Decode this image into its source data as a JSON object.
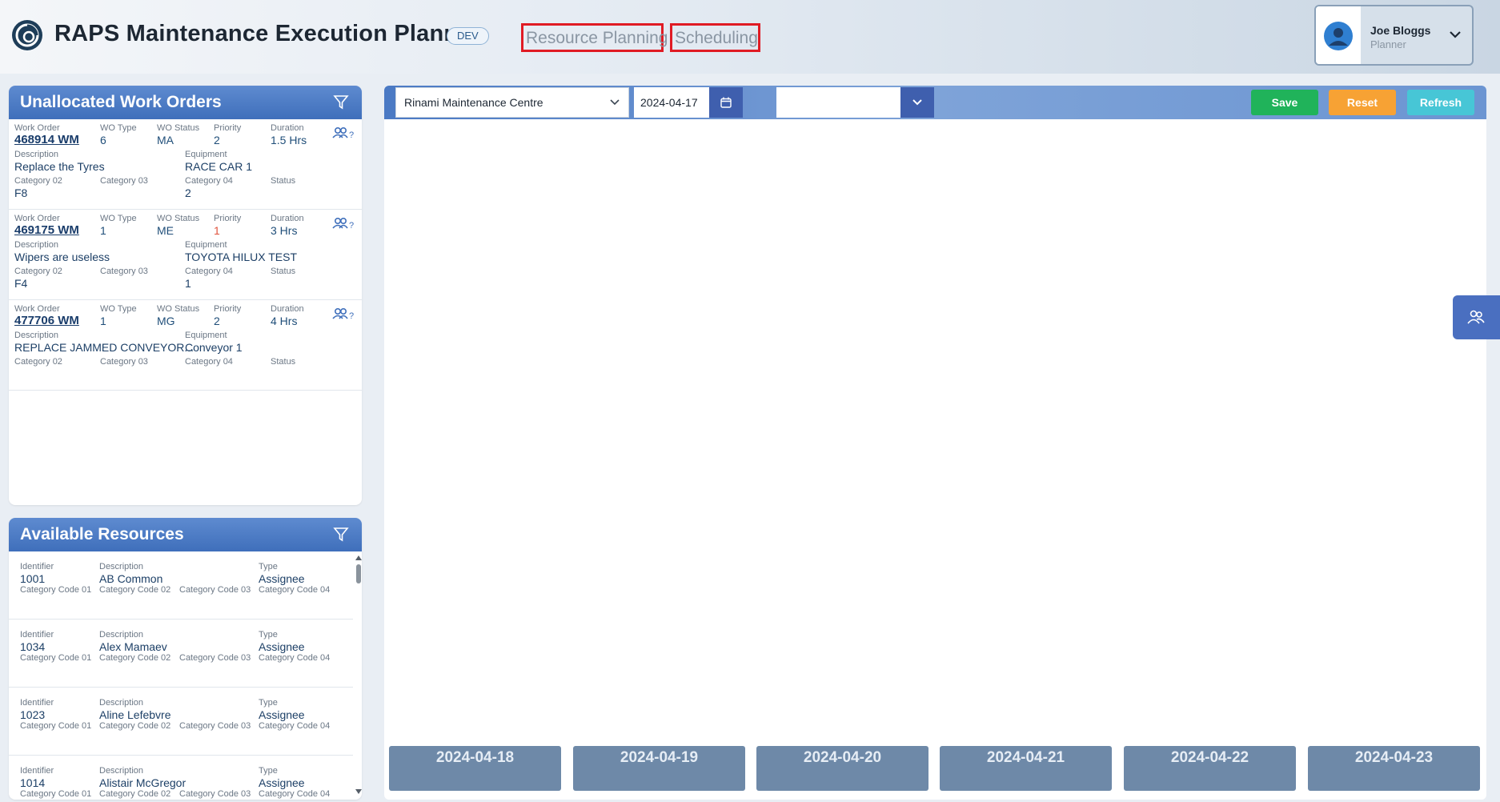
{
  "header": {
    "title": "RAPS Maintenance Execution Planner",
    "env_badge": "DEV",
    "nav": {
      "resource_planning": "Resource Planning",
      "scheduling": "Scheduling"
    },
    "user": {
      "name": "Joe Bloggs",
      "role": "Planner"
    }
  },
  "colors": {
    "accent": "#3f6fbb",
    "save": "#20b35a",
    "reset": "#f7a234",
    "refresh": "#47c6d6",
    "highlight": "#e01b24"
  },
  "work_orders": {
    "title": "Unallocated Work Orders",
    "labels": {
      "work_order": "Work Order",
      "wo_type": "WO Type",
      "wo_status": "WO Status",
      "priority": "Priority",
      "duration": "Duration",
      "description": "Description",
      "equipment": "Equipment",
      "cat02": "Category 02",
      "cat03": "Category 03",
      "cat04": "Category 04",
      "status": "Status"
    },
    "items": [
      {
        "number": "468914 WM",
        "type": "6",
        "status_code": "MA",
        "priority": "2",
        "duration": "1.5 Hrs",
        "description": "Replace the Tyres",
        "equipment": "RACE CAR 1",
        "cat02": "F8",
        "cat03": "",
        "cat04": "2",
        "status": ""
      },
      {
        "number": "469175 WM",
        "type": "1",
        "status_code": "ME",
        "priority": "1",
        "duration": "3 Hrs",
        "description": "Wipers are useless",
        "equipment": "TOYOTA HILUX TEST",
        "cat02": "F4",
        "cat03": "",
        "cat04": "1",
        "status": ""
      },
      {
        "number": "477706 WM",
        "type": "1",
        "status_code": "MG",
        "priority": "2",
        "duration": "4 Hrs",
        "description": "REPLACE JAMMED CONVEYOR...",
        "equipment": "Conveyor 1",
        "cat02": "",
        "cat03": "",
        "cat04": "",
        "status": ""
      }
    ],
    "assign_mark": "?"
  },
  "resources": {
    "title": "Available Resources",
    "labels": {
      "identifier": "Identifier",
      "description": "Description",
      "type": "Type",
      "cc01": "Category Code 01",
      "cc02": "Category Code 02",
      "cc03": "Category Code 03",
      "cc04": "Category Code 04"
    },
    "items": [
      {
        "id": "1001",
        "description": "AB Common",
        "type": "Assignee"
      },
      {
        "id": "1034",
        "description": "Alex Mamaev",
        "type": "Assignee"
      },
      {
        "id": "1023",
        "description": "Aline Lefebvre",
        "type": "Assignee"
      },
      {
        "id": "1014",
        "description": "Alistair McGregor",
        "type": "Assignee"
      }
    ]
  },
  "schedule": {
    "centre": "Rinami Maintenance Centre",
    "date": "2024-04-17",
    "secondary_select": "",
    "buttons": {
      "save": "Save",
      "reset": "Reset",
      "refresh": "Refresh"
    },
    "days": [
      "2024-04-18",
      "2024-04-19",
      "2024-04-20",
      "2024-04-21",
      "2024-04-22",
      "2024-04-23"
    ]
  }
}
